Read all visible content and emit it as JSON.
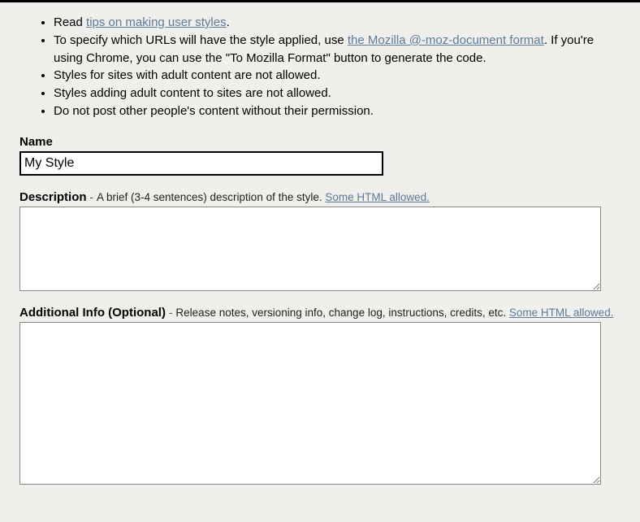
{
  "tips": {
    "items": [
      {
        "prefix": "Read ",
        "link": "tips on making user styles",
        "suffix": "."
      },
      {
        "prefix": "To specify which URLs will have the style applied, use ",
        "link": "the Mozilla @-moz-document format",
        "suffix": ". If you're using Chrome, you can use the \"To Mozilla Format\" button to generate the code."
      },
      {
        "text": "Styles for sites with adult content are not allowed."
      },
      {
        "text": "Styles adding adult content to sites are not allowed."
      },
      {
        "text": "Do not post other people's content without their permission."
      }
    ]
  },
  "form": {
    "name": {
      "label": "Name",
      "value": "My Style"
    },
    "description": {
      "label": "Description",
      "sep": " - ",
      "hint": "A brief (3-4 sentences) description of the style. ",
      "hint_link": "Some HTML allowed.",
      "value": ""
    },
    "additional": {
      "label": "Additional Info (Optional)",
      "sep": " - ",
      "hint": "Release notes, versioning info, change log, instructions, credits, etc. ",
      "hint_link": "Some HTML allowed.",
      "value": ""
    }
  }
}
